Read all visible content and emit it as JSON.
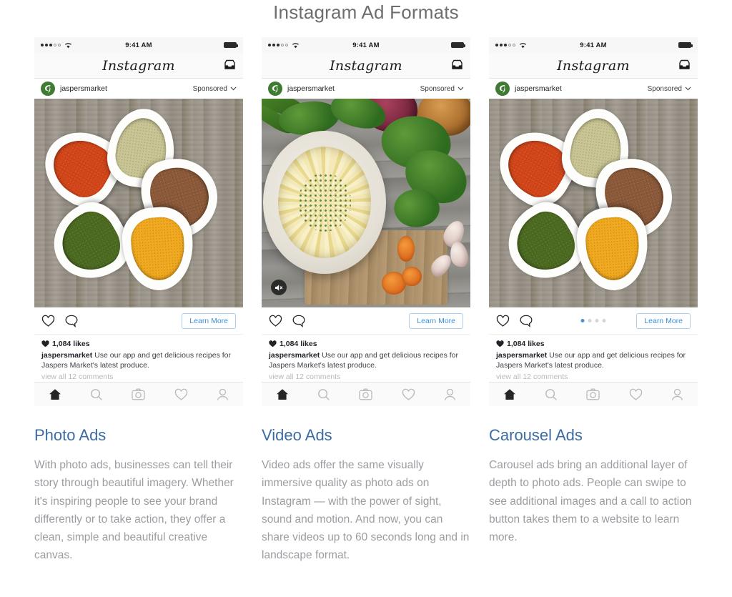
{
  "page": {
    "title": "Instagram Ad Formats"
  },
  "phone": {
    "status": {
      "time": "9:41 AM",
      "signal_filled": 3,
      "signal_empty": 2,
      "wifi_icon": "wifi-icon",
      "battery_icon": "battery-full-icon"
    },
    "navbar": {
      "wordmark": "Instagram",
      "inbox_icon": "inbox-icon"
    },
    "account": {
      "avatar_icon": "jaspers-market-avatar",
      "handle": "jaspersmarket",
      "sponsored_label": "Sponsored",
      "chevron_icon": "chevron-down-icon"
    },
    "actions": {
      "like_icon": "heart-outline-icon",
      "comment_icon": "comment-bubble-icon",
      "cta_label": "Learn More"
    },
    "caption": {
      "likes": "1,084 likes",
      "heart_icon": "heart-filled-icon",
      "author": "jaspersmarket",
      "text": "Use our app and get delicious recipes for Jaspers Market's latest produce.",
      "comments_link": "view all 12 comments"
    },
    "tabbar": {
      "home_icon": "home-icon",
      "search_icon": "search-icon",
      "camera_icon": "camera-icon",
      "activity_icon": "heart-outline-icon",
      "profile_icon": "person-icon"
    }
  },
  "video": {
    "audio_icon": "speaker-mute-icon"
  },
  "carousel": {
    "dots_total": 4,
    "dots_active_index": 0
  },
  "colors": {
    "accent_blue": "#3d90d7",
    "heading_blue": "#3c6ca4",
    "body_gray": "#9a9da1",
    "title_gray": "#6e6e6e",
    "avatar_green": "#3f7b32"
  },
  "sections": [
    {
      "id": "photo-ads",
      "heading": "Photo Ads",
      "body": "With photo ads, businesses can tell their story through beautiful imagery. Whether it's inspiring people to see your brand differently or to take action, they offer a clean, simple and beautiful creative canvas."
    },
    {
      "id": "video-ads",
      "heading": "Video Ads",
      "body": "Video ads offer the same visually immersive quality as photo ads on Instagram — with the power of sight, sound and motion. And now, you can share videos up to 60 seconds long and in landscape format."
    },
    {
      "id": "carousel-ads",
      "heading": "Carousel Ads",
      "body": "Carousel ads bring an additional layer of depth to photo ads. People can swipe to see additional images and a call to action button takes them to a website to learn more."
    }
  ]
}
